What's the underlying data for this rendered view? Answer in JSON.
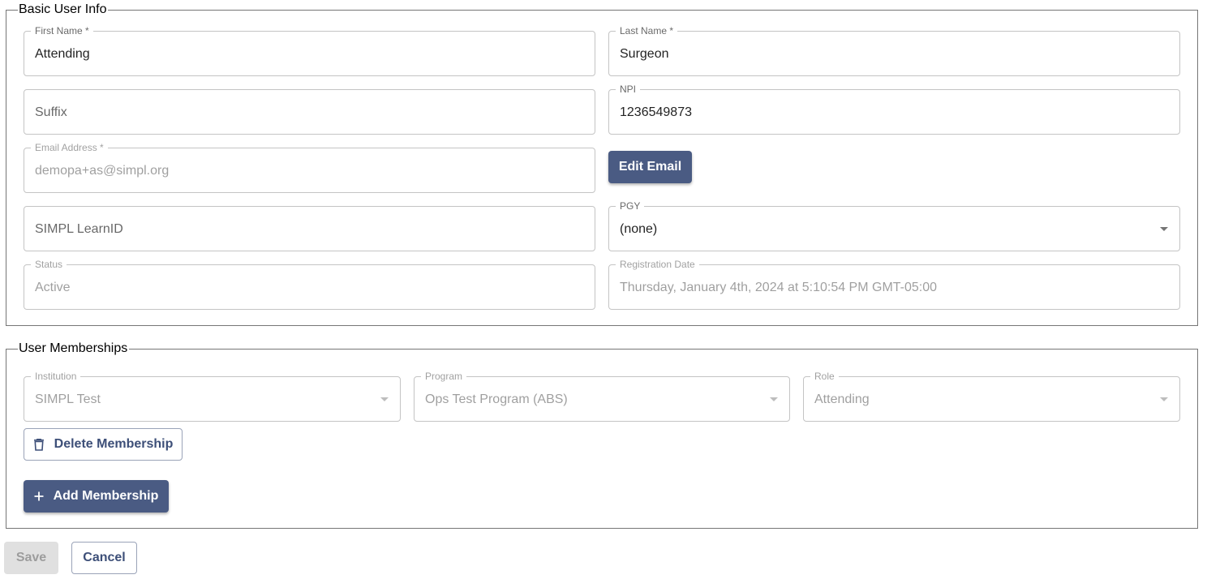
{
  "basic_info": {
    "legend": "Basic User Info",
    "first_name": {
      "label": "First Name *",
      "value": "Attending"
    },
    "last_name": {
      "label": "Last Name *",
      "value": "Surgeon"
    },
    "suffix": {
      "placeholder": "Suffix"
    },
    "npi": {
      "label": "NPI",
      "value": "1236549873"
    },
    "email": {
      "label": "Email Address *",
      "value": "demopa+as@simpl.org"
    },
    "edit_email_label": "Edit Email",
    "learn_id": {
      "placeholder": "SIMPL LearnID"
    },
    "pgy": {
      "label": "PGY",
      "value": "(none)"
    },
    "status": {
      "label": "Status",
      "value": "Active"
    },
    "registration_date": {
      "label": "Registration Date",
      "value": "Thursday, January 4th, 2024 at 5:10:54 PM GMT-05:00"
    }
  },
  "memberships": {
    "legend": "User Memberships",
    "institution": {
      "label": "Institution",
      "value": "SIMPL Test"
    },
    "program": {
      "label": "Program",
      "value": "Ops Test Program (ABS)"
    },
    "role": {
      "label": "Role",
      "value": "Attending"
    },
    "delete_label": "Delete Membership",
    "add_label": "Add Membership"
  },
  "footer": {
    "save_label": "Save",
    "cancel_label": "Cancel"
  },
  "colors": {
    "primary": "#4a5b83",
    "outline_text": "#3d4f78",
    "field_border": "#c4c4c4",
    "disabled_bg": "#e0e0e0"
  },
  "icons": {
    "delete": "trash-icon",
    "add": "plus-icon",
    "dropdown": "caret-down-icon"
  }
}
